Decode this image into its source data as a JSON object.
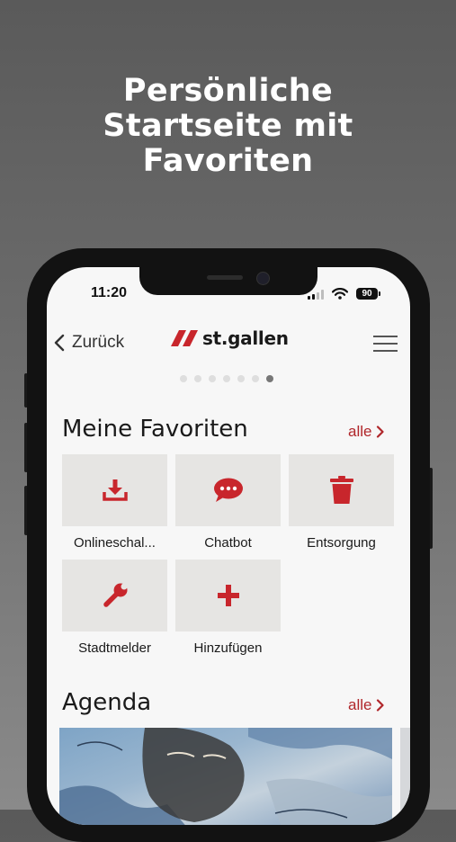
{
  "promo": {
    "headline_line1": "Persönliche",
    "headline_line2": "Startseite mit",
    "headline_line3": "Favoriten"
  },
  "status_bar": {
    "time": "11:20",
    "battery": "90"
  },
  "nav": {
    "back_label": "Zurück",
    "logo_text": "st.gallen"
  },
  "carousel": {
    "page_count": 7,
    "active_index": 6
  },
  "favorites": {
    "title": "Meine Favoriten",
    "all_label": "alle",
    "items": [
      {
        "label": "Onlineschal...",
        "icon": "download-icon"
      },
      {
        "label": "Chatbot",
        "icon": "chat-bubble-icon"
      },
      {
        "label": "Entsorgung",
        "icon": "trash-icon"
      },
      {
        "label": "Stadtmelder",
        "icon": "wrench-icon"
      },
      {
        "label": "Hinzufügen",
        "icon": "plus-icon"
      }
    ]
  },
  "agenda": {
    "title": "Agenda",
    "all_label": "alle"
  },
  "colors": {
    "accent": "#b0262a",
    "tile_bg": "#e6e5e3",
    "screen_bg": "#f7f7f7"
  }
}
